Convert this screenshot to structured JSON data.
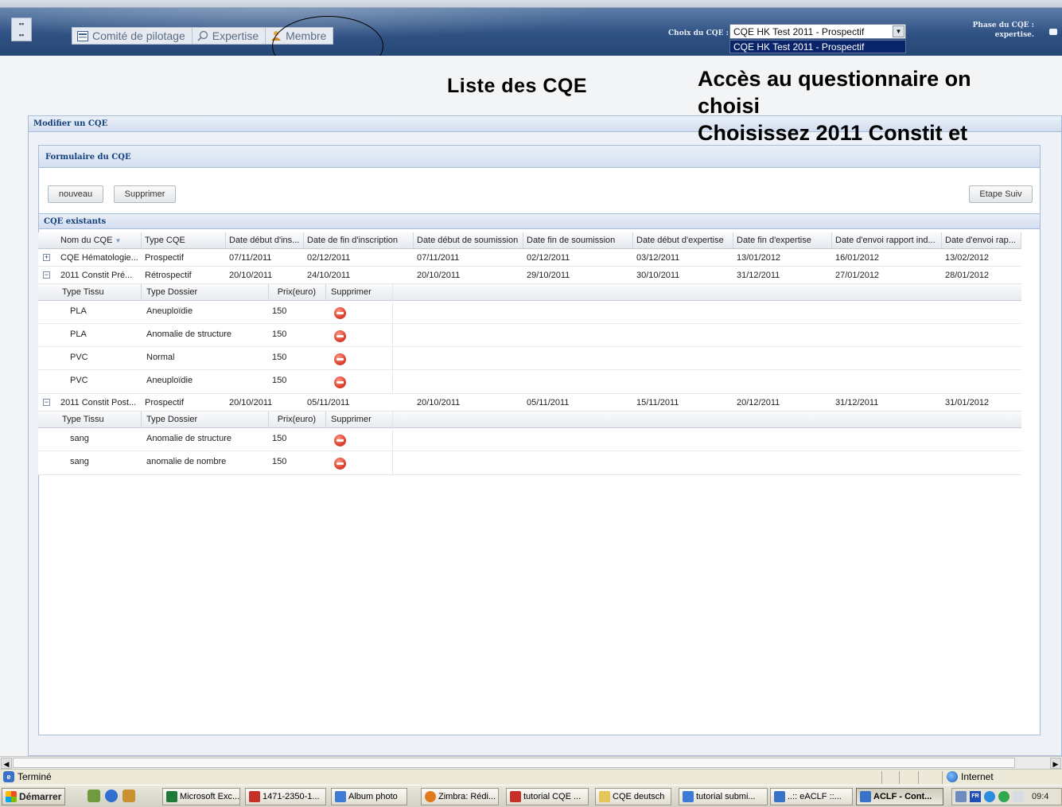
{
  "header": {
    "tabs": [
      {
        "label": "Comité de pilotage",
        "icon": "committee-icon"
      },
      {
        "label": "Expertise",
        "icon": "search-icon"
      },
      {
        "label": "Membre",
        "icon": "user-icon"
      }
    ],
    "cqe_choice_label": "Choix du CQE :",
    "cqe_select_value": "CQE HK Test 2011 - Prospectif",
    "cqe_dropdown_option": "CQE HK Test 2011 - Prospectif",
    "phase_label": "Phase du CQE :",
    "phase_value": "expertise."
  },
  "page_title": "Liste des CQE",
  "overlay": {
    "line1": "Accès au questionnaire on",
    "line2": "choisi",
    "line3": "Choisissez 2011 Constit et"
  },
  "outer_panel": {
    "title": "Modifier un CQE"
  },
  "form_panel": {
    "title": "Formulaire du CQE",
    "btn_new": "nouveau",
    "btn_delete": "Supprimer",
    "btn_next": "Etape Suiv"
  },
  "grid": {
    "title": "CQE existants",
    "sort_indicator": "▼",
    "columns": [
      "Nom du CQE",
      "Type CQE",
      "Date début d'ins...",
      "Date de fin d'inscription",
      "Date début de soumission",
      "Date fin de soumission",
      "Date début d'expertise",
      "Date fin d'expertise",
      "Date d'envoi rapport ind...",
      "Date d'envoi rap..."
    ],
    "rows": [
      {
        "expander": "+",
        "cells": [
          "CQE Hématologie...",
          "Prospectif",
          "07/11/2011",
          "02/12/2011",
          "07/11/2011",
          "02/12/2011",
          "03/12/2011",
          "13/01/2012",
          "16/01/2012",
          "13/02/2012"
        ]
      },
      {
        "expander": "−",
        "cells": [
          "2011 Constit Pré...",
          "Rétrospectif",
          "20/10/2011",
          "24/10/2011",
          "20/10/2011",
          "29/10/2011",
          "30/10/2011",
          "31/12/2011",
          "27/01/2012",
          "28/01/2012"
        ]
      },
      {
        "expander": "−",
        "cells": [
          "2011 Constit Post...",
          "Prospectif",
          "20/10/2011",
          "05/11/2011",
          "20/10/2011",
          "05/11/2011",
          "15/11/2011",
          "20/12/2011",
          "31/12/2011",
          "31/01/2012"
        ]
      }
    ],
    "sub_columns": [
      "Type Tissu",
      "Type Dossier",
      "Prix(euro)",
      "Supprimer"
    ],
    "sub1": [
      {
        "tissu": "PLA",
        "dossier": "Aneuploïdie",
        "prix": "150"
      },
      {
        "tissu": "PLA",
        "dossier": "Anomalie de structure",
        "prix": "150"
      },
      {
        "tissu": "PVC",
        "dossier": "Normal",
        "prix": "150"
      },
      {
        "tissu": "PVC",
        "dossier": "Aneuploïdie",
        "prix": "150"
      }
    ],
    "sub2": [
      {
        "tissu": "sang",
        "dossier": "Anomalie de structure",
        "prix": "150"
      },
      {
        "tissu": "sang",
        "dossier": "anomalie de nombre",
        "prix": "150"
      }
    ]
  },
  "statusbar": {
    "status": "Terminé",
    "zone": "Internet"
  },
  "taskbar": {
    "start": "Démarrer",
    "tasks": [
      "Microsoft Exc...",
      "1471-2350-1...",
      "Album photo",
      "Zimbra: Rédi...",
      "tutorial CQE ...",
      "CQE deutsch",
      "tutorial submi...",
      "..:: eACLF ::...",
      "ACLF - Cont..."
    ],
    "lang": "FR",
    "clock": "09:4"
  }
}
